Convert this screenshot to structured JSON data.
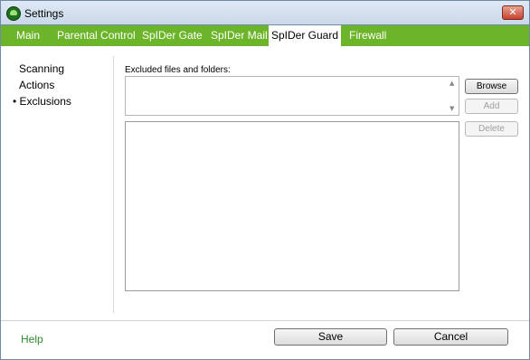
{
  "window": {
    "title": "Settings",
    "close_symbol": "✕"
  },
  "tabs": [
    {
      "label": "Main"
    },
    {
      "label": "Parental Control"
    },
    {
      "label": "SpIDer Gate"
    },
    {
      "label": "SpIDer Mail"
    },
    {
      "label": "SpIDer Guard",
      "active": true
    },
    {
      "label": "Firewall"
    }
  ],
  "sidebar": {
    "items": [
      {
        "label": "Scanning"
      },
      {
        "label": "Actions"
      },
      {
        "label": "• Exclusions",
        "selected": true
      }
    ]
  },
  "exclusions": {
    "label": "Excluded files and folders:",
    "path_value": "",
    "list_items": []
  },
  "buttons": {
    "browse": "Browse",
    "add": "Add",
    "delete": "Delete",
    "save": "Save",
    "cancel": "Cancel"
  },
  "footer": {
    "help": "Help"
  },
  "colors": {
    "tab_bar": "#6cb52a",
    "help_link": "#2e8b2e",
    "close_button": "#c8412c"
  }
}
